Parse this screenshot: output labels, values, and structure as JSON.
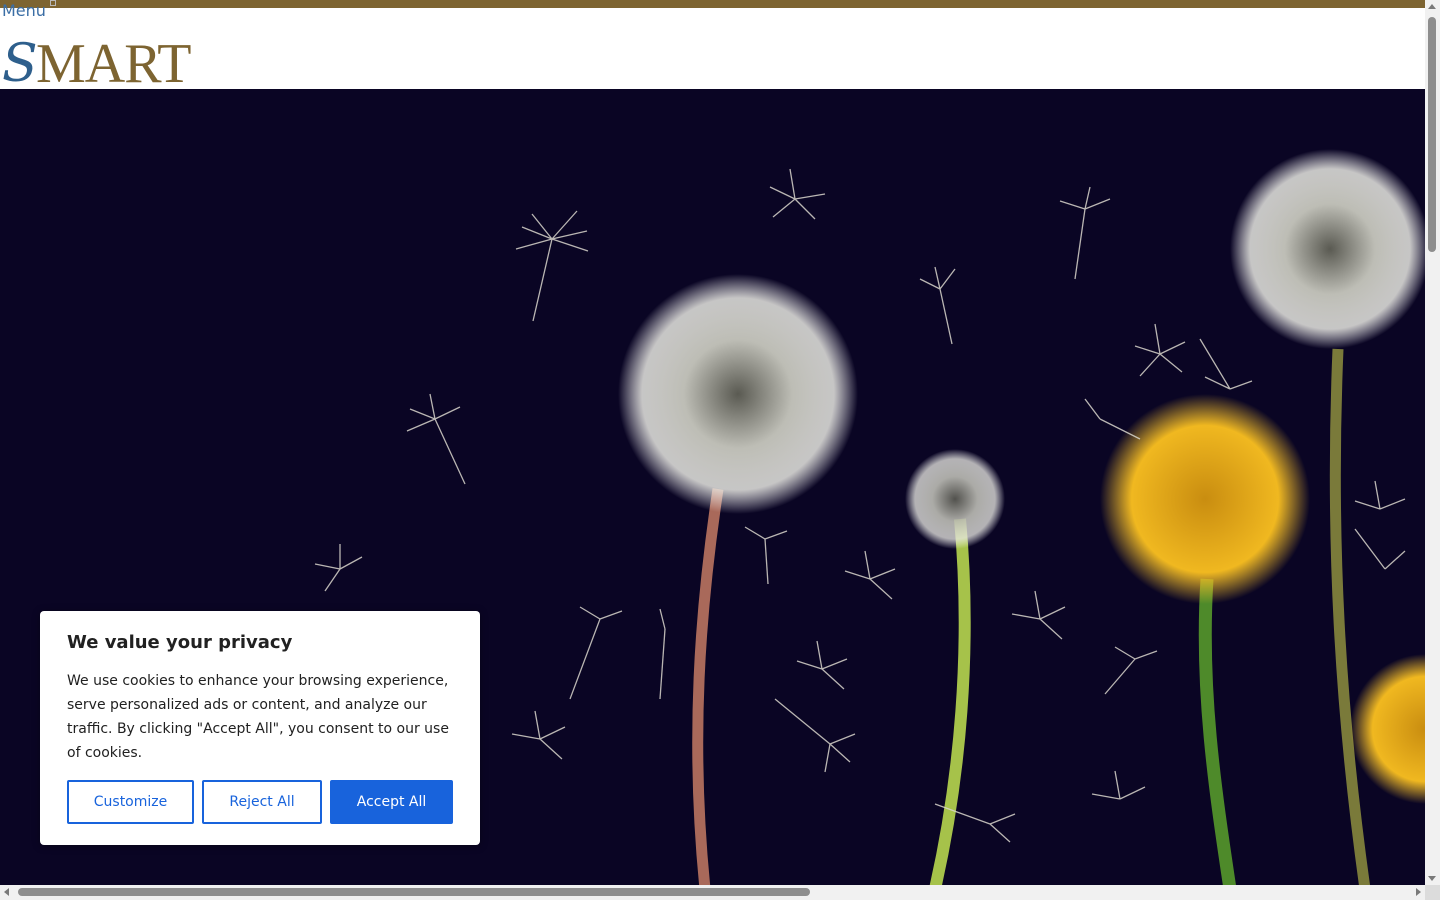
{
  "header": {
    "menu_label": "Menu",
    "logo_initial": "S",
    "logo_rest": "MART"
  },
  "hero": {
    "image": "dandelion-seed-heads-on-dark-background"
  },
  "cookie_banner": {
    "title": "We value your privacy",
    "body": "We use cookies to enhance your browsing experience, serve personalized ads or content, and analyze our traffic. By clicking \"Accept All\", you consent to our use of cookies.",
    "customize_label": "Customize",
    "reject_label": "Reject All",
    "accept_label": "Accept All"
  },
  "colors": {
    "brand_gold": "#7d6431",
    "brand_blue": "#2e5f8c",
    "hero_background": "#0a0524",
    "button_blue": "#1863dc"
  }
}
